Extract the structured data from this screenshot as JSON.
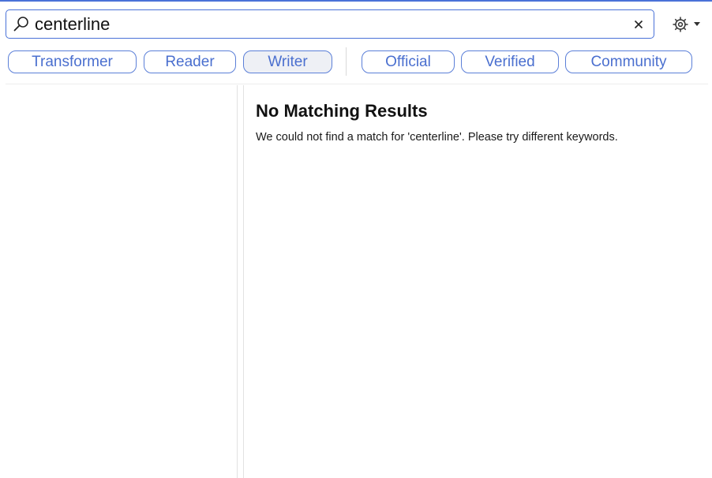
{
  "search": {
    "value": "centerline",
    "icon": "search-icon",
    "clear_label": "×"
  },
  "settings": {
    "icon": "gear-icon",
    "dropdown_icon": "caret-down-icon"
  },
  "filters": {
    "type_chips": [
      {
        "label": "Transformer",
        "active": false
      },
      {
        "label": "Reader",
        "active": false
      },
      {
        "label": "Writer",
        "active": true
      }
    ],
    "source_chips": [
      {
        "label": "Official",
        "active": false
      },
      {
        "label": "Verified",
        "active": false
      },
      {
        "label": "Community",
        "active": false
      }
    ]
  },
  "results": {
    "title": "No Matching Results",
    "message": "We could not find a match for 'centerline'. Please try different keywords."
  },
  "colors": {
    "accent": "#4a72d8",
    "chip_text": "#4a6fcf",
    "chip_active_bg": "#eef0f5"
  }
}
